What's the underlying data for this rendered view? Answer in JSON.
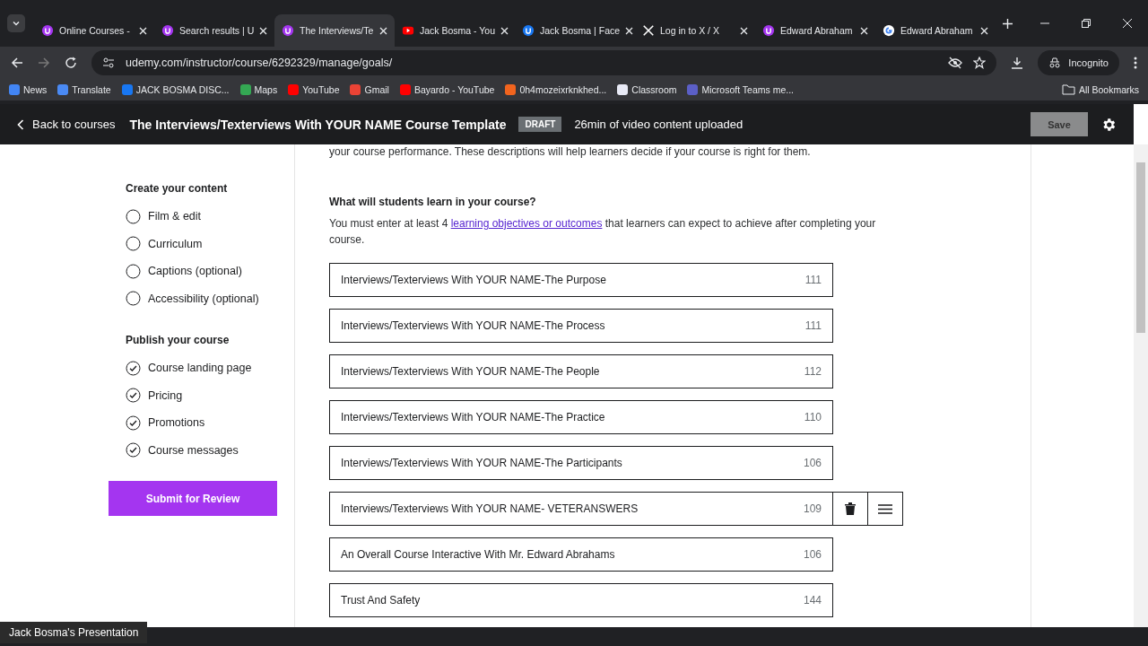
{
  "browser": {
    "tabs": [
      {
        "title": "Online Courses -",
        "kind": "udemy",
        "selected": false
      },
      {
        "title": "Search results | U",
        "kind": "udemy",
        "selected": false
      },
      {
        "title": "The Interviews/Te",
        "kind": "udemy",
        "selected": true
      },
      {
        "title": "Jack Bosma - You",
        "kind": "youtube",
        "selected": false
      },
      {
        "title": "Jack Bosma | Face",
        "kind": "facebook",
        "selected": false
      },
      {
        "title": "Log in to X / X",
        "kind": "x",
        "selected": false
      },
      {
        "title": "Edward Abraham",
        "kind": "udemy",
        "selected": false
      },
      {
        "title": "Edward Abraham",
        "kind": "google",
        "selected": false
      }
    ],
    "url": "udemy.com/instructor/course/6292329/manage/goals/",
    "incognito_label": "Incognito",
    "bookmarks": [
      {
        "label": "News",
        "kind": "news"
      },
      {
        "label": "Translate",
        "kind": "translate"
      },
      {
        "label": "JACK BOSMA DISC...",
        "kind": "facebook"
      },
      {
        "label": "Maps",
        "kind": "maps"
      },
      {
        "label": "YouTube",
        "kind": "youtube"
      },
      {
        "label": "Gmail",
        "kind": "gmail"
      },
      {
        "label": "Bayardo - YouTube",
        "kind": "youtube"
      },
      {
        "label": "0h4mozeixrknkhed...",
        "kind": "etsy"
      },
      {
        "label": "Classroom",
        "kind": "sk"
      },
      {
        "label": "Microsoft Teams me...",
        "kind": "teams"
      }
    ],
    "all_bookmarks": "All Bookmarks"
  },
  "header": {
    "back": "Back to courses",
    "title": "The Interviews/Texterviews With YOUR NAME Course Template",
    "badge": "DRAFT",
    "status": "26min of video content uploaded",
    "save": "Save",
    "save_disabled": true
  },
  "sidebar": {
    "sections": [
      {
        "title": "Create your content",
        "items": [
          {
            "label": "Film & edit",
            "checked": false
          },
          {
            "label": "Curriculum",
            "checked": false
          },
          {
            "label": "Captions (optional)",
            "checked": false
          },
          {
            "label": "Accessibility (optional)",
            "checked": false
          }
        ]
      },
      {
        "title": "Publish your course",
        "items": [
          {
            "label": "Course landing page",
            "checked": true
          },
          {
            "label": "Pricing",
            "checked": true
          },
          {
            "label": "Promotions",
            "checked": true
          },
          {
            "label": "Course messages",
            "checked": true
          }
        ]
      }
    ],
    "submit": "Submit for Review"
  },
  "main": {
    "intro_tail": "your course performance. These descriptions will help learners decide if your course is right for them.",
    "question": "What will students learn in your course?",
    "hint_before": "You must enter at least 4 ",
    "hint_link": "learning objectives or outcomes",
    "hint_after": " that learners can expect to achieve after completing your course.",
    "objectives": [
      {
        "value": "Interviews/Texterviews With YOUR NAME-The Purpose",
        "count": "111",
        "hovered": false
      },
      {
        "value": "Interviews/Texterviews With YOUR NAME-The Process",
        "count": "111",
        "hovered": false
      },
      {
        "value": "Interviews/Texterviews With YOUR NAME-The People",
        "count": "112",
        "hovered": false
      },
      {
        "value": "Interviews/Texterviews With YOUR NAME-The Practice",
        "count": "110",
        "hovered": false
      },
      {
        "value": "Interviews/Texterviews With YOUR NAME-The Participants",
        "count": "106",
        "hovered": false
      },
      {
        "value": "Interviews/Texterviews With YOUR NAME- VETERANSWERS",
        "count": "109",
        "hovered": true
      },
      {
        "value": "An Overall Course Interactive With Mr. Edward Abrahams",
        "count": "106",
        "hovered": false
      },
      {
        "value": "Trust And Safety",
        "count": "144",
        "hovered": false
      }
    ]
  },
  "presenter_label": "Jack Bosma's Presentation"
}
